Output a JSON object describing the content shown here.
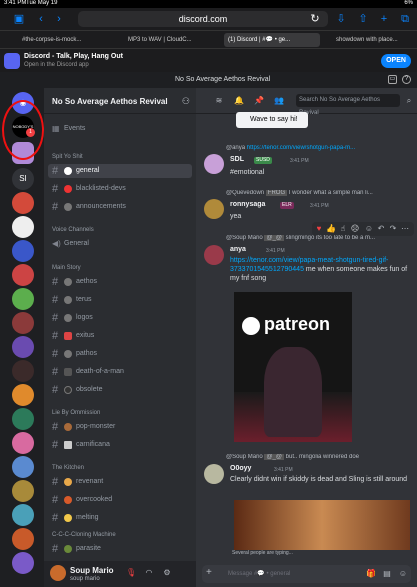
{
  "status": {
    "time": "3:41 PM",
    "date": "Tue May 19",
    "battery": "6%"
  },
  "browser": {
    "address": "discord.com",
    "tabs": [
      "#the-corpse-is-mock...",
      "MP3 to WAV | CloudC...",
      "(1) Discord | #💬 • ge...",
      "showdown with place..."
    ]
  },
  "banner": {
    "title": "Discord - Talk, Play, Hang Out",
    "subtitle": "Open in the Discord app",
    "open_label": "OPEN"
  },
  "server_strip": {
    "title": "No So Average Aethos Revival"
  },
  "rail": {
    "server_text": "SI",
    "highlight_text": "NOBODY'S",
    "mention_count": "1"
  },
  "sidebar": {
    "server_name": "No So Average Aethos Revival",
    "events_label": "Events",
    "categories": [
      {
        "name": "Spit Yo Shit",
        "channels": [
          "general",
          "blacklisted-devs",
          "announcements"
        ]
      },
      {
        "name": "Voice Channels",
        "channels": [
          "General"
        ]
      },
      {
        "name": "Main Story",
        "channels": [
          "aethos",
          "terus",
          "logos",
          "exitus",
          "pathos",
          "death-of-a-man",
          "obsolete"
        ]
      },
      {
        "name": "Lie By Ommission",
        "channels": [
          "pop-monster",
          "carnificana"
        ]
      },
      {
        "name": "The Kitchen",
        "channels": [
          "revenant",
          "overcooked",
          "melting"
        ]
      },
      {
        "name": "C-C-C-Cloning Machine",
        "channels": [
          "parasite"
        ]
      }
    ],
    "user": {
      "name": "Soup Mario",
      "status": "soup mario"
    }
  },
  "chat": {
    "search_placeholder": "Search No So Average Aethos Revival",
    "wave_label": "Wave to say hi!",
    "messages": [
      {
        "reply_user": "@anya",
        "reply_text": "https://tenor.com/view/shotgun-papa-m...",
        "author": "SDL",
        "tag": "SUSD",
        "time": "3:41 PM",
        "text": "#emotional"
      },
      {
        "reply_user": "@Quevedown",
        "reply_tag": "FROG",
        "reply_text": "I wonder what a simple man li...",
        "author": "ronnysaga",
        "tag": "ELR",
        "time": "3:41 PM",
        "text": "yea"
      },
      {
        "reply_user": "@Soup Mario",
        "reply_tag": "@_@",
        "reply_text": "slingmingo its too late to be a m...",
        "author": "anya",
        "time": "3:41 PM",
        "link": "https://tenor.com/view/papa-meat-shotgun-tired-gif-3733701545512790445",
        "text": "me when someone makes fun of my fnf song",
        "embed_text": "patreon"
      },
      {
        "reply_user": "@Soup Mario",
        "reply_tag": "@_@",
        "reply_text": "but.. mingolia winnered doe",
        "author": "O0oyy",
        "time": "3:41 PM",
        "text": "Clearly didnt win if skiddy is dead and Sling is still around"
      }
    ],
    "typing": "Several people are typing...",
    "composer_placeholder": "Message #💬 • general"
  },
  "colors": {
    "accent": "#5865f2",
    "link": "#00a8fc",
    "mention": "#f23f42",
    "browser_blue": "#0a84ff"
  }
}
